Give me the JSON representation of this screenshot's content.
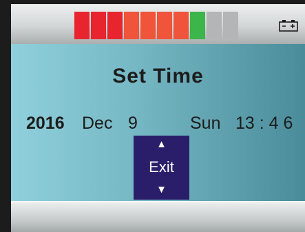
{
  "status_bar": {
    "battery_segments": [
      {
        "color": "#e8252e"
      },
      {
        "color": "#e8252e"
      },
      {
        "color": "#e8252e"
      },
      {
        "color": "#f0543a"
      },
      {
        "color": "#f0543a"
      },
      {
        "color": "#f0543a"
      },
      {
        "color": "#f0543a"
      },
      {
        "color": "#3cb54a"
      },
      {
        "color": "#b3b5b6"
      },
      {
        "color": "#b3b5b6"
      }
    ],
    "battery_icon": "battery-icon"
  },
  "screen": {
    "title": "Set Time",
    "datetime": {
      "year": "2016",
      "month": "Dec",
      "day": "9",
      "weekday": "Sun",
      "time": "13 : 4 6"
    }
  },
  "exit_button": {
    "label": "Exit",
    "up_glyph": "▲",
    "down_glyph": "▼",
    "color": "#2a1e6b"
  },
  "colors": {
    "background_left": "#8fd0dc",
    "background_right": "#4a8c9a",
    "frame": "#1c1c1c"
  }
}
